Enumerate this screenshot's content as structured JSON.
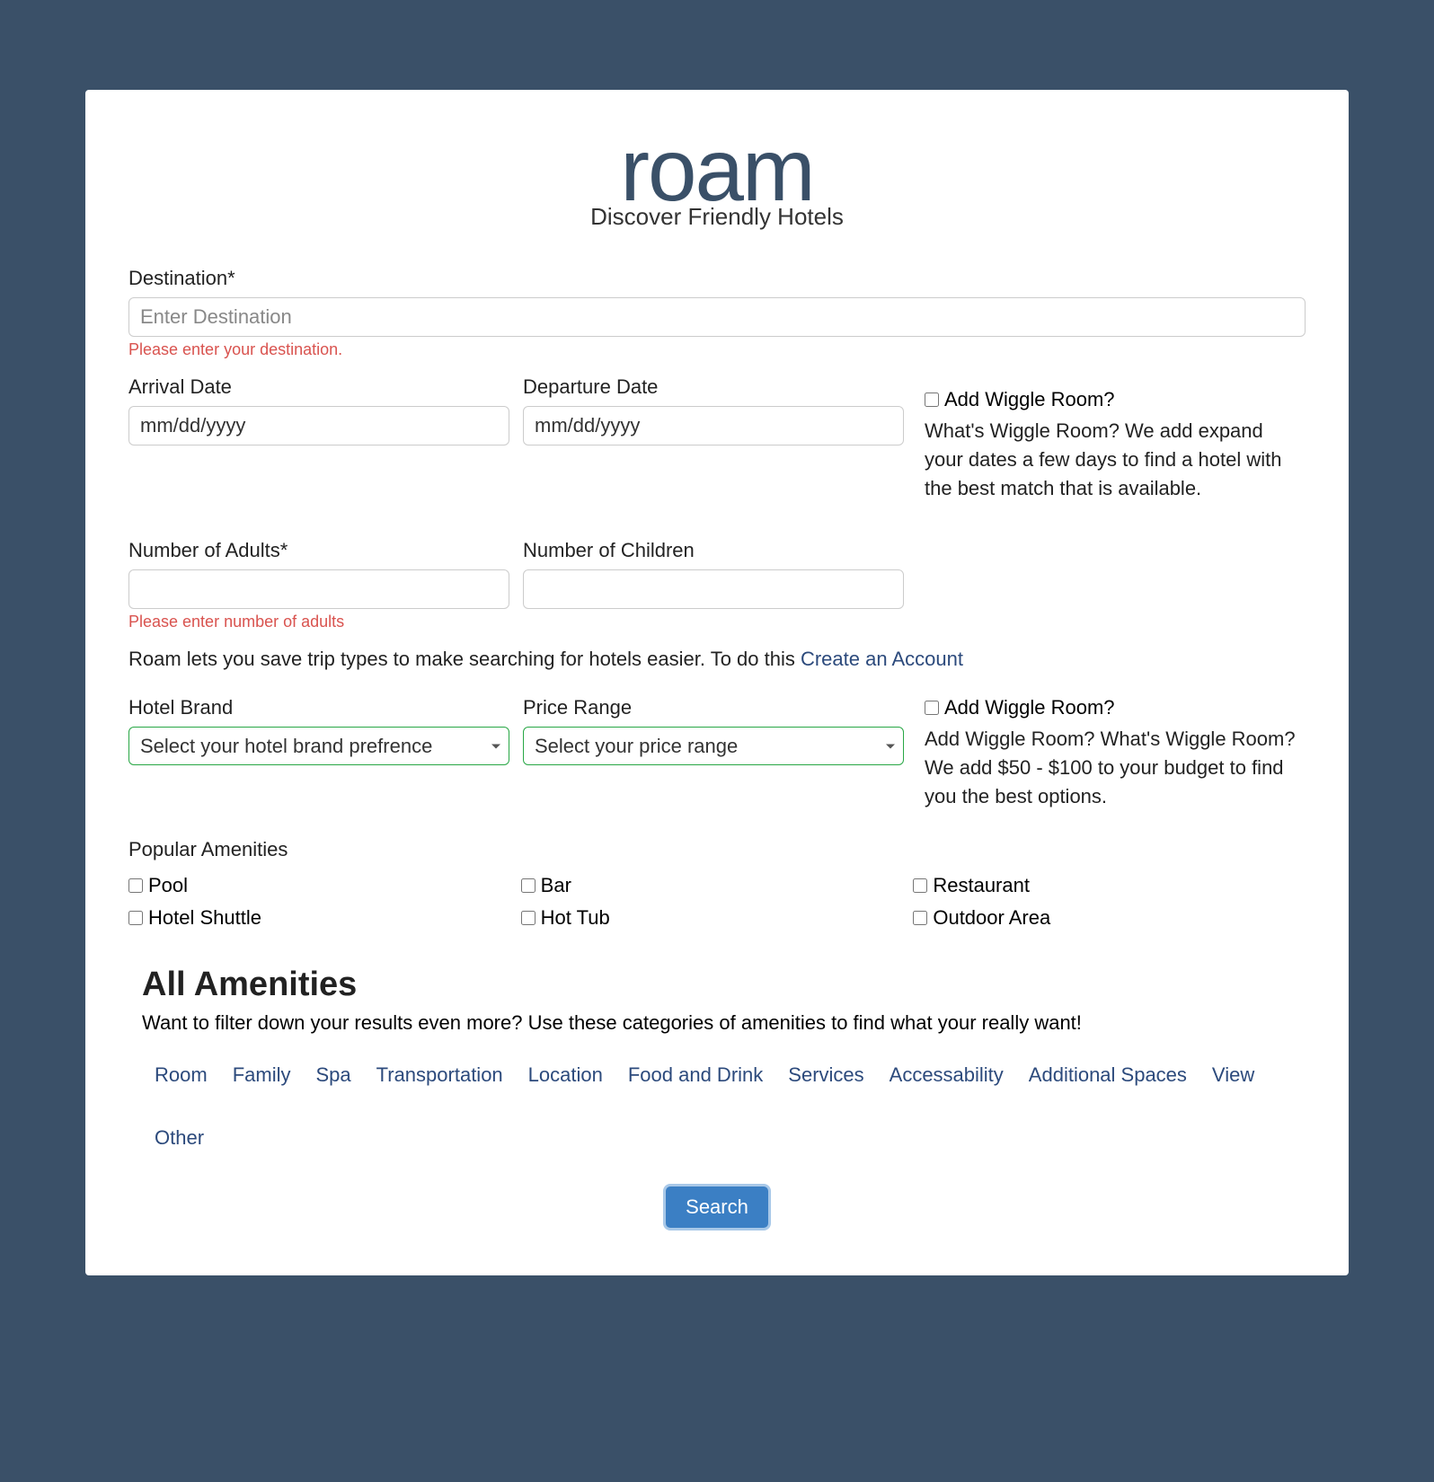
{
  "logo": {
    "brand": "roam",
    "tagline": "Discover Friendly Hotels"
  },
  "destination": {
    "label": "Destination*",
    "placeholder": "Enter Destination",
    "error": "Please enter your destination."
  },
  "dates": {
    "arrival_label": "Arrival Date",
    "arrival_value": "mm/dd/yyyy",
    "departure_label": "Departure Date",
    "departure_value": "mm/dd/yyyy",
    "wiggle_label": "Add Wiggle Room?",
    "wiggle_desc": "What's Wiggle Room? We add expand your dates a few days to find a hotel with the best match that is available."
  },
  "guests": {
    "adults_label": "Number of Adults*",
    "adults_error": "Please enter number of adults",
    "children_label": "Number of Children"
  },
  "account_info": {
    "text": "Roam lets you save trip types to make searching for hotels easier. To do this ",
    "link": "Create an Account"
  },
  "filters": {
    "brand_label": "Hotel Brand",
    "brand_placeholder": "Select your hotel brand prefrence",
    "price_label": "Price Range",
    "price_placeholder": "Select your price range",
    "wiggle_label": "Add Wiggle Room?",
    "wiggle_desc": "Add Wiggle Room? What's Wiggle Room? We add $50 - $100 to your budget to find you the best options."
  },
  "popular_amenities": {
    "heading": "Popular Amenities",
    "items": [
      "Pool",
      "Bar",
      "Restaurant",
      "Hotel Shuttle",
      "Hot Tub",
      "Outdoor Area"
    ]
  },
  "all_amenities": {
    "heading": "All Amenities",
    "desc": "Want to filter down your results even more? Use these categories of amenities to find what your really want!",
    "tabs": [
      "Room",
      "Family",
      "Spa",
      "Transportation",
      "Location",
      "Food and Drink",
      "Services",
      "Accessability",
      "Additional Spaces",
      "View",
      "Other"
    ]
  },
  "search_button": "Search"
}
